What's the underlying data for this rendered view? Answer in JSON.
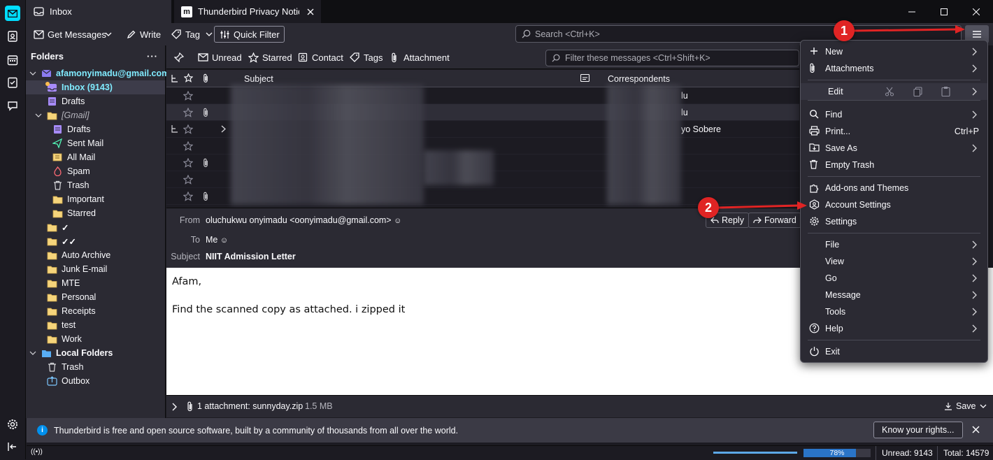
{
  "tabs": [
    {
      "label": "Inbox"
    },
    {
      "label": "Thunderbird Privacy Notice"
    }
  ],
  "toolbar": {
    "get_messages": "Get Messages",
    "write": "Write",
    "tag": "Tag",
    "quick_filter": "Quick Filter",
    "search_placeholder": "Search <Ctrl+K>"
  },
  "folders": {
    "header": "Folders",
    "account": "afamonyimadu@gmail.com",
    "inbox": "Inbox (9143)",
    "drafts": "Drafts",
    "gmail": "[Gmail]",
    "gmail_children": [
      "Drafts",
      "Sent Mail",
      "All Mail",
      "Spam",
      "Trash",
      "Important",
      "Starred"
    ],
    "others": [
      "✓",
      "✓✓",
      "Auto Archive",
      "Junk E-mail",
      "MTE",
      "Personal",
      "Receipts",
      "test",
      "Work"
    ],
    "local": "Local Folders",
    "local_children": [
      "Trash",
      "Outbox"
    ]
  },
  "quickfilter": {
    "unread": "Unread",
    "starred": "Starred",
    "contact": "Contact",
    "tags": "Tags",
    "attachment": "Attachment",
    "filter_placeholder": "Filter these messages <Ctrl+Shift+K>"
  },
  "columns": {
    "subject": "Subject",
    "correspondents": "Correspondents"
  },
  "threads": [
    {
      "correspondent": "lu",
      "attachment": false,
      "thread": false
    },
    {
      "correspondent": "lu",
      "attachment": true,
      "thread": false
    },
    {
      "correspondent": "yo Sobere",
      "attachment": false,
      "thread": true
    },
    {
      "correspondent": "",
      "attachment": false,
      "thread": false
    },
    {
      "correspondent": "",
      "attachment": true,
      "thread": false
    },
    {
      "correspondent": "",
      "attachment": false,
      "thread": false
    },
    {
      "correspondent": "",
      "attachment": true,
      "thread": false
    }
  ],
  "message": {
    "from_label": "From",
    "from": "oluchukwu onyimadu <oonyimadu@gmail.com>",
    "to_label": "To",
    "to": "Me",
    "subject_label": "Subject",
    "subject": "NIIT Admission Letter",
    "reply": "Reply",
    "forward": "Forward",
    "body_line1": "Afam,",
    "body_line2": "Find the scanned copy as attached. i zipped it"
  },
  "attachment_bar": {
    "text": "1 attachment: sunnyday.zip",
    "size": "1.5 MB",
    "save": "Save"
  },
  "notice": {
    "text": "Thunderbird is free and open source software, built by a community of thousands from all over the world.",
    "button": "Know your rights..."
  },
  "status": {
    "progress_label": "78%",
    "progress": 0.78,
    "unread": "Unread: 9143",
    "total": "Total: 14579"
  },
  "appmenu": {
    "new": "New",
    "attachments": "Attachments",
    "edit": "Edit",
    "find": "Find",
    "print": "Print...",
    "print_shortcut": "Ctrl+P",
    "save_as": "Save As",
    "empty_trash": "Empty Trash",
    "addons": "Add-ons and Themes",
    "account_settings": "Account Settings",
    "settings": "Settings",
    "file": "File",
    "view": "View",
    "go": "Go",
    "message": "Message",
    "tools": "Tools",
    "help": "Help",
    "exit": "Exit"
  },
  "annotations": {
    "badge1": "1",
    "badge2": "2",
    "color": "#e02424"
  }
}
